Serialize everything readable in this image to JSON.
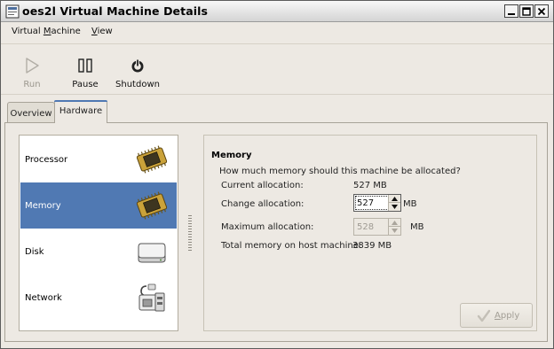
{
  "window": {
    "title": "oes2l Virtual Machine Details",
    "controls": [
      "minimize",
      "maximize",
      "close"
    ]
  },
  "menubar": {
    "items": [
      {
        "label_pre": "Virtual ",
        "label_ul": "M",
        "label_post": "achine"
      },
      {
        "label_pre": "",
        "label_ul": "V",
        "label_post": "iew"
      }
    ]
  },
  "toolbar": {
    "run_label": "Run",
    "pause_label": "Pause",
    "shutdown_label": "Shutdown"
  },
  "tabs": [
    {
      "label": "Overview",
      "active": false
    },
    {
      "label": "Hardware",
      "active": true
    }
  ],
  "devices": [
    {
      "label": "Processor",
      "icon": "processor-chip-icon",
      "selected": false
    },
    {
      "label": "Memory",
      "icon": "memory-chip-icon",
      "selected": true
    },
    {
      "label": "Disk",
      "icon": "disk-drive-icon",
      "selected": false
    },
    {
      "label": "Network",
      "icon": "network-adapter-icon",
      "selected": false
    }
  ],
  "memory": {
    "heading": "Memory",
    "question": "How much memory should this machine be allocated?",
    "current_label": "Current allocation:",
    "current_value": "527 MB",
    "change_label": "Change allocation:",
    "change_value": "527",
    "change_unit": "MB",
    "max_label": "Maximum allocation:",
    "max_value": "528",
    "max_unit": "MB",
    "host_label": "Total memory on host machine:",
    "host_value": "3839 MB"
  },
  "apply": {
    "label_ul": "A",
    "label_post": "pply",
    "enabled": false
  },
  "colors": {
    "selection": "#5079b3",
    "tab_highlight": "#4f78b3",
    "window_bg": "#ede9e3"
  }
}
